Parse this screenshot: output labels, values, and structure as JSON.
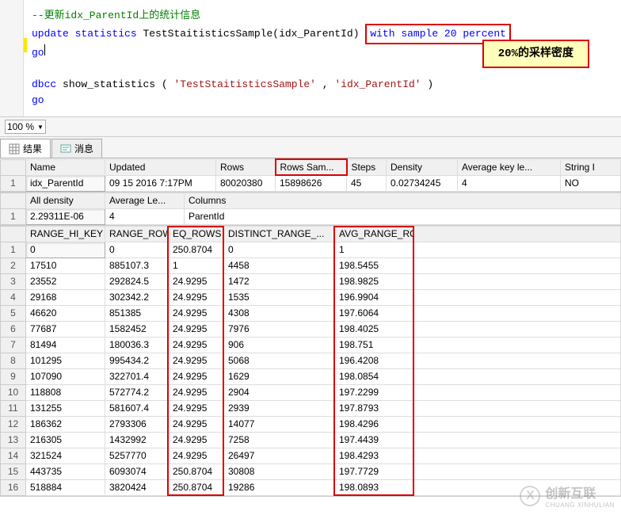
{
  "editor": {
    "comment": "--更新idx_ParentId上的统计信息",
    "kw_update": "update",
    "kw_statistics": "statistics",
    "obj": " TestStaitisticsSample(idx_ParentId) ",
    "with_clause": "with sample 20 percent",
    "go1": "go",
    "dbcc_kw": "dbcc",
    "show_stats": " show_statistics",
    "paren_open": "(",
    "str1": "'TestStaitisticsSample'",
    "comma": ",",
    "str2": "'idx_ParentId'",
    "paren_close": ")",
    "go2": "go"
  },
  "callout": "20%的采样密度",
  "zoom": "100 %",
  "tabs": {
    "results": "结果",
    "messages": "消息"
  },
  "table1": {
    "headers": [
      "Name",
      "Updated",
      "Rows",
      "Rows Sam...",
      "Steps",
      "Density",
      "Average key le...",
      "String I"
    ],
    "row_num": "1",
    "cells": [
      "idx_ParentId",
      "09 15 2016  7:17PM",
      "80020380",
      "15898626",
      "45",
      "0.02734245",
      "4",
      "NO"
    ]
  },
  "table2": {
    "headers": [
      "All density",
      "Average Le...",
      "Columns"
    ],
    "row_num": "1",
    "cells": [
      "2.29311E-06",
      "4",
      "ParentId"
    ]
  },
  "table3": {
    "headers": [
      "RANGE_HI_KEY",
      "RANGE_ROWS",
      "EQ_ROWS",
      "DISTINCT_RANGE_...",
      "AVG_RANGE_ROWS"
    ],
    "rows": [
      {
        "n": "1",
        "c": [
          "0",
          "0",
          "250.8704",
          "0",
          "1"
        ]
      },
      {
        "n": "2",
        "c": [
          "17510",
          "885107.3",
          "1",
          "4458",
          "198.5455"
        ]
      },
      {
        "n": "3",
        "c": [
          "23552",
          "292824.5",
          "24.9295",
          "1472",
          "198.9825"
        ]
      },
      {
        "n": "4",
        "c": [
          "29168",
          "302342.2",
          "24.9295",
          "1535",
          "196.9904"
        ]
      },
      {
        "n": "5",
        "c": [
          "46620",
          "851385",
          "24.9295",
          "4308",
          "197.6064"
        ]
      },
      {
        "n": "6",
        "c": [
          "77687",
          "1582452",
          "24.9295",
          "7976",
          "198.4025"
        ]
      },
      {
        "n": "7",
        "c": [
          "81494",
          "180036.3",
          "24.9295",
          "906",
          "198.751"
        ]
      },
      {
        "n": "8",
        "c": [
          "101295",
          "995434.2",
          "24.9295",
          "5068",
          "196.4208"
        ]
      },
      {
        "n": "9",
        "c": [
          "107090",
          "322701.4",
          "24.9295",
          "1629",
          "198.0854"
        ]
      },
      {
        "n": "10",
        "c": [
          "118808",
          "572774.2",
          "24.9295",
          "2904",
          "197.2299"
        ]
      },
      {
        "n": "11",
        "c": [
          "131255",
          "581607.4",
          "24.9295",
          "2939",
          "197.8793"
        ]
      },
      {
        "n": "12",
        "c": [
          "186362",
          "2793306",
          "24.9295",
          "14077",
          "198.4296"
        ]
      },
      {
        "n": "13",
        "c": [
          "216305",
          "1432992",
          "24.9295",
          "7258",
          "197.4439"
        ]
      },
      {
        "n": "14",
        "c": [
          "321524",
          "5257770",
          "24.9295",
          "26497",
          "198.4293"
        ]
      },
      {
        "n": "15",
        "c": [
          "443735",
          "6093074",
          "250.8704",
          "30808",
          "197.7729"
        ]
      },
      {
        "n": "16",
        "c": [
          "518884",
          "3820424",
          "250.8704",
          "19286",
          "198.0893"
        ]
      }
    ]
  },
  "watermark": {
    "brand": "创新互联",
    "sub": "CHUANG XINHULIAN"
  }
}
